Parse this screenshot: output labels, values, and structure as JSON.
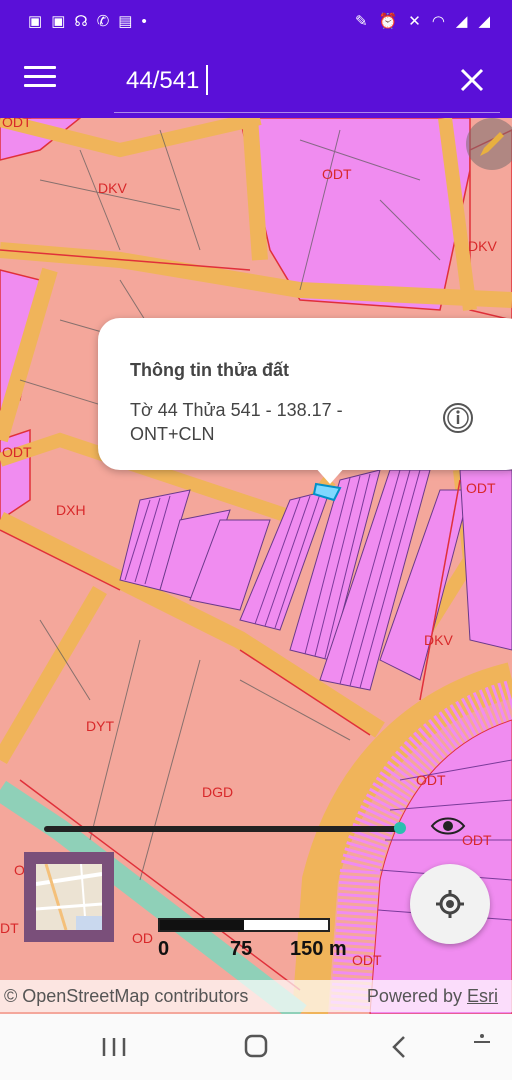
{
  "status_bar": {
    "left_icons": [
      "image-icon",
      "image-icon",
      "wifi-icon",
      "missed-call-icon",
      "calendar-icon",
      "dot-icon"
    ],
    "right_icons": [
      "pen-icon",
      "alarm-icon",
      "mute-icon",
      "wifi-icon",
      "signal-icon",
      "signal-icon"
    ]
  },
  "app_bar": {
    "search_value": "44/541",
    "menu_icon": "menu-icon",
    "close_icon": "close-icon",
    "background": "#5a10d8"
  },
  "map": {
    "zone_labels": [
      "ODT",
      "DKV",
      "ODT",
      "DKV",
      "ODT",
      "DXH",
      "ODT",
      "DKV",
      "DYT",
      "DGD",
      "ODT",
      "ODT",
      "OD",
      "OD",
      "ODT",
      "DT"
    ],
    "colors": {
      "residential": "#f08cf0",
      "agricultural": "#f4a79b",
      "road": "#f0b45a",
      "boundary": "#e0303a",
      "selected": "#7fd8ff"
    }
  },
  "popup": {
    "title": "Thông tin thửa đất",
    "body": "Tờ 44 Thửa 541 - 138.17 - ONT+CLN",
    "info_icon": "info-icon"
  },
  "scale": {
    "labels": [
      "0",
      "75",
      "150 m"
    ]
  },
  "attribution": {
    "osm": "© OpenStreetMap contributors",
    "powered_by": "Powered by",
    "esri": "Esri"
  },
  "nav": {
    "recent": "recent-apps-icon",
    "home": "home-icon",
    "back": "back-icon"
  }
}
